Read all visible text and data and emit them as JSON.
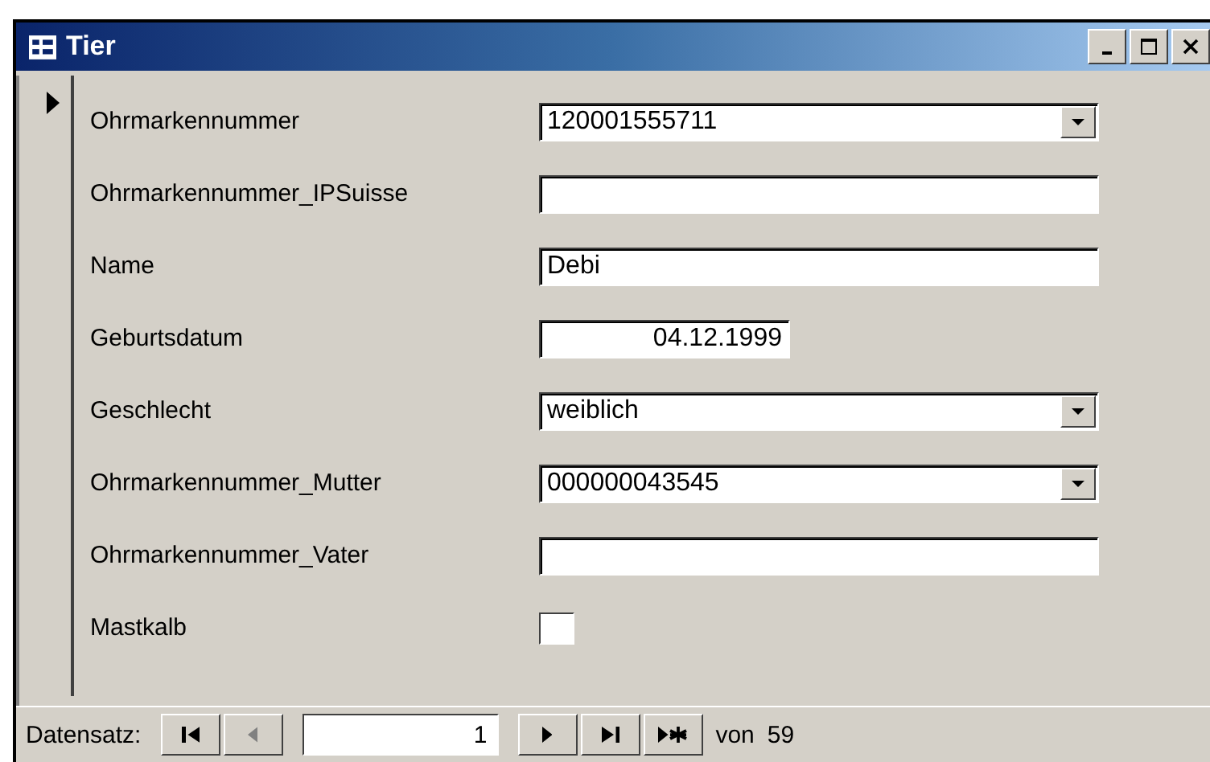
{
  "window": {
    "title": "Tier"
  },
  "record_selector": {
    "current": true
  },
  "fields": [
    {
      "label": "Ohrmarkennummer",
      "kind": "combo",
      "value": "120001555711"
    },
    {
      "label": "Ohrmarkennummer_IPSuisse",
      "kind": "text"
    },
    {
      "label": "Name",
      "kind": "text",
      "value": "Debi"
    },
    {
      "label": "Geburtsdatum",
      "kind": "date",
      "value": "04.12.1999"
    },
    {
      "label": "Geschlecht",
      "kind": "combo",
      "value": "weiblich"
    },
    {
      "label": "Ohrmarkennummer_Mutter",
      "kind": "combo",
      "value": "000000043545"
    },
    {
      "label": "Ohrmarkennummer_Vater",
      "kind": "text"
    },
    {
      "label": "Mastkalb",
      "kind": "checkbox",
      "checked": false
    }
  ],
  "navigation": {
    "label": "Datensatz:",
    "record": "1",
    "of_label": "von",
    "total": "59",
    "buttons": [
      {
        "kind": "first",
        "disabled": false
      },
      {
        "kind": "prev",
        "disabled": true
      }
    ],
    "buttons_after": [
      {
        "kind": "next",
        "disabled": false
      },
      {
        "kind": "last",
        "disabled": false
      },
      {
        "kind": "new",
        "disabled": false
      }
    ]
  }
}
